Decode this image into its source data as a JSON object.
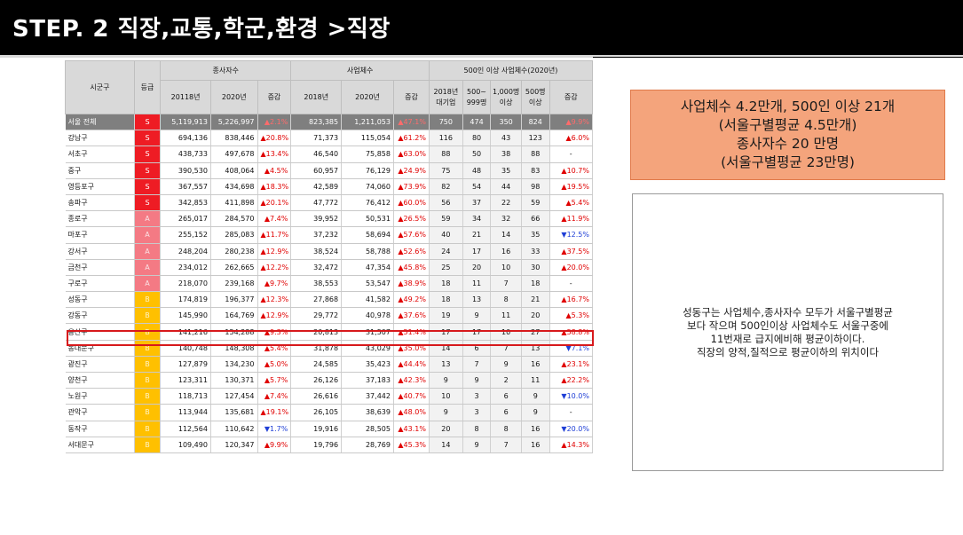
{
  "title": "STEP. 2  직장,교통,학군,환경 >직장",
  "table": {
    "headers": {
      "district": "시군구",
      "grade": "등급",
      "workers_group": "종사자수",
      "biz_group": "사업체수",
      "big_group": "500인 이상 사업체수(2020년)",
      "w2018": "20118년",
      "w2020": "2020년",
      "wchg": "증감",
      "b2018": "2018년",
      "b2020": "2020년",
      "bchg": "증감",
      "l2018": "2018년\n대기업",
      "l500": "500~\n999명",
      "l1000": "1,000명\n이상",
      "l5000": "500명\n이상",
      "lchg": "증감"
    },
    "rows": [
      {
        "district": "서울 전체",
        "grade": "S",
        "w2018": "5,119,913",
        "w2020": "5,226,997",
        "wchg": "▲2.1%",
        "b2018": "823,385",
        "b2020": "1,211,053",
        "bchg": "▲47.1%",
        "l2018": "750",
        "l500": "474",
        "l1000": "350",
        "l5000": "824",
        "lchg": "▲9.9%",
        "total": true
      },
      {
        "district": "강남구",
        "grade": "S",
        "w2018": "694,136",
        "w2020": "838,446",
        "wchg": "▲20.8%",
        "b2018": "71,373",
        "b2020": "115,054",
        "bchg": "▲61.2%",
        "l2018": "116",
        "l500": "80",
        "l1000": "43",
        "l5000": "123",
        "lchg": "▲6.0%"
      },
      {
        "district": "서초구",
        "grade": "S",
        "w2018": "438,733",
        "w2020": "497,678",
        "wchg": "▲13.4%",
        "b2018": "46,540",
        "b2020": "75,858",
        "bchg": "▲63.0%",
        "l2018": "88",
        "l500": "50",
        "l1000": "38",
        "l5000": "88",
        "lchg": "-"
      },
      {
        "district": "중구",
        "grade": "S",
        "w2018": "390,530",
        "w2020": "408,064",
        "wchg": "▲4.5%",
        "b2018": "60,957",
        "b2020": "76,129",
        "bchg": "▲24.9%",
        "l2018": "75",
        "l500": "48",
        "l1000": "35",
        "l5000": "83",
        "lchg": "▲10.7%"
      },
      {
        "district": "영등포구",
        "grade": "S",
        "w2018": "367,557",
        "w2020": "434,698",
        "wchg": "▲18.3%",
        "b2018": "42,589",
        "b2020": "74,060",
        "bchg": "▲73.9%",
        "l2018": "82",
        "l500": "54",
        "l1000": "44",
        "l5000": "98",
        "lchg": "▲19.5%"
      },
      {
        "district": "송파구",
        "grade": "S",
        "w2018": "342,853",
        "w2020": "411,898",
        "wchg": "▲20.1%",
        "b2018": "47,772",
        "b2020": "76,412",
        "bchg": "▲60.0%",
        "l2018": "56",
        "l500": "37",
        "l1000": "22",
        "l5000": "59",
        "lchg": "▲5.4%"
      },
      {
        "district": "종로구",
        "grade": "A",
        "w2018": "265,017",
        "w2020": "284,570",
        "wchg": "▲7.4%",
        "b2018": "39,952",
        "b2020": "50,531",
        "bchg": "▲26.5%",
        "l2018": "59",
        "l500": "34",
        "l1000": "32",
        "l5000": "66",
        "lchg": "▲11.9%"
      },
      {
        "district": "마포구",
        "grade": "A",
        "w2018": "255,152",
        "w2020": "285,083",
        "wchg": "▲11.7%",
        "b2018": "37,232",
        "b2020": "58,694",
        "bchg": "▲57.6%",
        "l2018": "40",
        "l500": "21",
        "l1000": "14",
        "l5000": "35",
        "lchg": "▼12.5%"
      },
      {
        "district": "강서구",
        "grade": "A",
        "w2018": "248,204",
        "w2020": "280,238",
        "wchg": "▲12.9%",
        "b2018": "38,524",
        "b2020": "58,788",
        "bchg": "▲52.6%",
        "l2018": "24",
        "l500": "17",
        "l1000": "16",
        "l5000": "33",
        "lchg": "▲37.5%"
      },
      {
        "district": "금천구",
        "grade": "A",
        "w2018": "234,012",
        "w2020": "262,665",
        "wchg": "▲12.2%",
        "b2018": "32,472",
        "b2020": "47,354",
        "bchg": "▲45.8%",
        "l2018": "25",
        "l500": "20",
        "l1000": "10",
        "l5000": "30",
        "lchg": "▲20.0%"
      },
      {
        "district": "구로구",
        "grade": "A",
        "w2018": "218,070",
        "w2020": "239,168",
        "wchg": "▲9.7%",
        "b2018": "38,553",
        "b2020": "53,547",
        "bchg": "▲38.9%",
        "l2018": "18",
        "l500": "11",
        "l1000": "7",
        "l5000": "18",
        "lchg": "-"
      },
      {
        "district": "성동구",
        "grade": "B",
        "w2018": "174,819",
        "w2020": "196,377",
        "wchg": "▲12.3%",
        "b2018": "27,868",
        "b2020": "41,582",
        "bchg": "▲49.2%",
        "l2018": "18",
        "l500": "13",
        "l1000": "8",
        "l5000": "21",
        "lchg": "▲16.7%"
      },
      {
        "district": "강동구",
        "grade": "B",
        "w2018": "145,990",
        "w2020": "164,769",
        "wchg": "▲12.9%",
        "b2018": "29,772",
        "b2020": "40,978",
        "bchg": "▲37.6%",
        "l2018": "19",
        "l500": "9",
        "l1000": "11",
        "l5000": "20",
        "lchg": "▲5.3%"
      },
      {
        "district": "용산구",
        "grade": "B",
        "w2018": "141,216",
        "w2020": "154,288",
        "wchg": "▲9.3%",
        "b2018": "20,813",
        "b2020": "31,507",
        "bchg": "▲51.4%",
        "l2018": "17",
        "l500": "17",
        "l1000": "10",
        "l5000": "27",
        "lchg": "▲58.8%"
      },
      {
        "district": "동대문구",
        "grade": "B",
        "w2018": "140,748",
        "w2020": "148,308",
        "wchg": "▲5.4%",
        "b2018": "31,878",
        "b2020": "43,029",
        "bchg": "▲35.0%",
        "l2018": "14",
        "l500": "6",
        "l1000": "7",
        "l5000": "13",
        "lchg": "▼7.1%"
      },
      {
        "district": "광진구",
        "grade": "B",
        "w2018": "127,879",
        "w2020": "134,230",
        "wchg": "▲5.0%",
        "b2018": "24,585",
        "b2020": "35,423",
        "bchg": "▲44.4%",
        "l2018": "13",
        "l500": "7",
        "l1000": "9",
        "l5000": "16",
        "lchg": "▲23.1%"
      },
      {
        "district": "양천구",
        "grade": "B",
        "w2018": "123,311",
        "w2020": "130,371",
        "wchg": "▲5.7%",
        "b2018": "26,126",
        "b2020": "37,183",
        "bchg": "▲42.3%",
        "l2018": "9",
        "l500": "9",
        "l1000": "2",
        "l5000": "11",
        "lchg": "▲22.2%"
      },
      {
        "district": "노원구",
        "grade": "B",
        "w2018": "118,713",
        "w2020": "127,454",
        "wchg": "▲7.4%",
        "b2018": "26,616",
        "b2020": "37,442",
        "bchg": "▲40.7%",
        "l2018": "10",
        "l500": "3",
        "l1000": "6",
        "l5000": "9",
        "lchg": "▼10.0%"
      },
      {
        "district": "관악구",
        "grade": "B",
        "w2018": "113,944",
        "w2020": "135,681",
        "wchg": "▲19.1%",
        "b2018": "26,105",
        "b2020": "38,639",
        "bchg": "▲48.0%",
        "l2018": "9",
        "l500": "3",
        "l1000": "6",
        "l5000": "9",
        "lchg": "-"
      },
      {
        "district": "동작구",
        "grade": "B",
        "w2018": "112,564",
        "w2020": "110,642",
        "wchg": "▼1.7%",
        "b2018": "19,916",
        "b2020": "28,505",
        "bchg": "▲43.1%",
        "l2018": "20",
        "l500": "8",
        "l1000": "8",
        "l5000": "16",
        "lchg": "▼20.0%"
      },
      {
        "district": "서대문구",
        "grade": "B",
        "w2018": "109,490",
        "w2020": "120,347",
        "wchg": "▲9.9%",
        "b2018": "19,796",
        "b2020": "28,769",
        "bchg": "▲45.3%",
        "l2018": "14",
        "l500": "9",
        "l1000": "7",
        "l5000": "16",
        "lchg": "▲14.3%"
      }
    ]
  },
  "summary": {
    "line1": "사업체수 4.2만개, 500인 이상 21개",
    "line2": "(서울구별평균 4.5만개)",
    "line3": "종사자수 20 만명",
    "line4": "(서울구별평균 23만명)"
  },
  "note": {
    "line1": "성동구는 사업체수,종사자수 모두가 서울구별평균",
    "line2": "보다 작으며 500인이상 사업체수도 서울구중에",
    "line3": "11번재로 급지에비해 평균이하이다.",
    "line4": "직장의 양적,질적으로 평균이하의 위치이다"
  },
  "colors": {
    "grade_S": "#ee1c24",
    "grade_A": "#f47a84",
    "grade_B": "#ffc000",
    "increase": "#e00000",
    "decrease": "#1f3fd6",
    "summary_bg": "#f4a47c",
    "highlight": "#d7191c"
  }
}
